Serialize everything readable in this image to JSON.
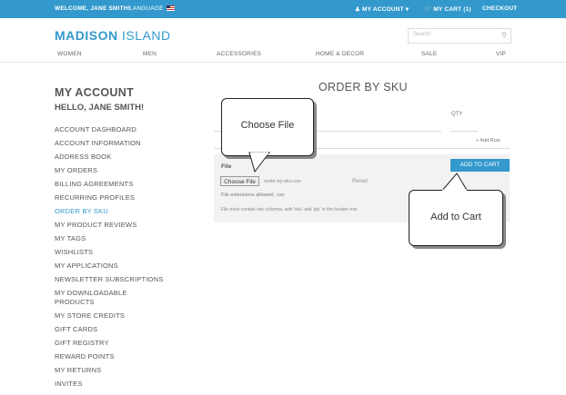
{
  "topbar": {
    "welcome": "WELCOME, JANE SMITH!",
    "language": "LANGUAGE",
    "account": "MY ACCOUNT",
    "cart": "MY CART (1)",
    "checkout": "CHECKOUT"
  },
  "header": {
    "logo_bold": "MADISON",
    "logo_light": "ISLAND",
    "search_placeholder": "Search"
  },
  "nav": [
    "WOMEN",
    "MEN",
    "ACCESSORIES",
    "HOME & DECOR",
    "SALE",
    "VIP"
  ],
  "sidebar": {
    "title": "MY ACCOUNT",
    "hello": "HELLO, JANE SMITH!",
    "items": [
      {
        "label": "ACCOUNT DASHBOARD"
      },
      {
        "label": "ACCOUNT INFORMATION"
      },
      {
        "label": "ADDRESS BOOK"
      },
      {
        "label": "MY ORDERS"
      },
      {
        "label": "BILLING AGREEMENTS"
      },
      {
        "label": "RECURRING PROFILES"
      },
      {
        "label": "ORDER BY SKU"
      },
      {
        "label": "MY PRODUCT REVIEWS"
      },
      {
        "label": "MY TAGS"
      },
      {
        "label": "WISHLISTS"
      },
      {
        "label": "MY APPLICATIONS"
      },
      {
        "label": "NEWSLETTER SUBSCRIPTIONS"
      },
      {
        "label": "MY DOWNLOADABLE PRODUCTS"
      },
      {
        "label": "MY STORE CREDITS"
      },
      {
        "label": "GIFT CARDS"
      },
      {
        "label": "GIFT REGISTRY"
      },
      {
        "label": "REWARD POINTS"
      },
      {
        "label": "MY RETURNS"
      },
      {
        "label": "INVITES"
      }
    ],
    "active_index": 6
  },
  "main": {
    "title": "ORDER BY SKU",
    "qty_label": "QTY",
    "add_row": "+ Add Row",
    "file_label": "File",
    "choose_file": "Choose File",
    "file_name": "order-by-sku.csv",
    "reset": "Reset",
    "allowed": "File extensions allowed: .csv",
    "note": "File must contain two columns, with 'sku' and 'qty' in the header row",
    "add_to_cart": "ADD TO CART"
  },
  "callouts": {
    "choose_file": "Choose File",
    "add_to_cart": "Add to Cart"
  },
  "colors": {
    "accent": "#3399cc",
    "text": "#555555"
  }
}
